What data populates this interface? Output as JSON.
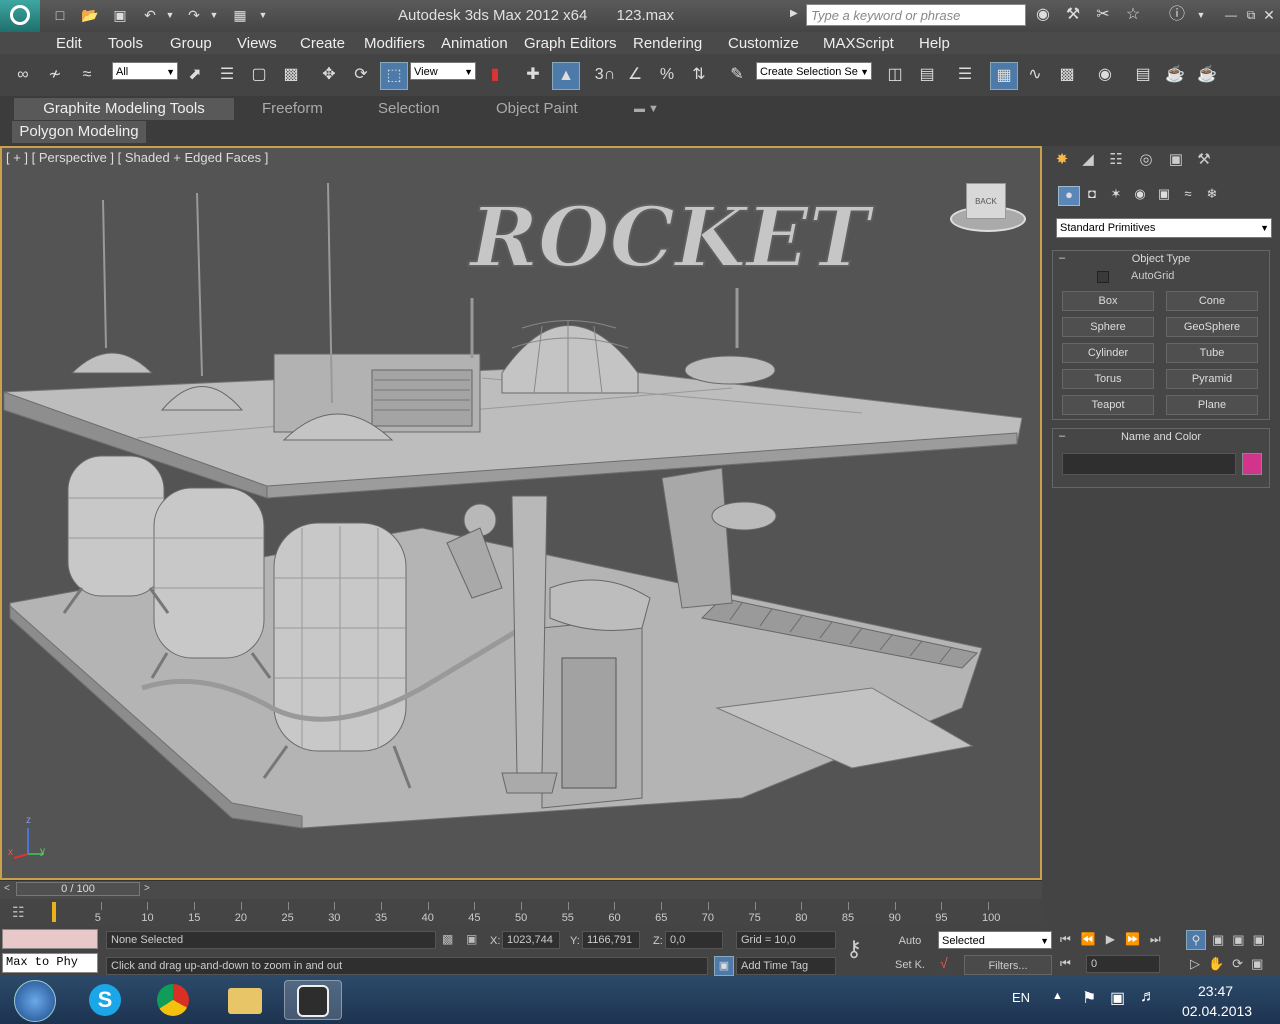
{
  "title_bar": {
    "app_title": "Autodesk 3ds Max  2012 x64",
    "file_name": "123.max",
    "search_placeholder": "Type a keyword or phrase"
  },
  "menu": [
    "Edit",
    "Tools",
    "Group",
    "Views",
    "Create",
    "Modifiers",
    "Animation",
    "Graph Editors",
    "Rendering",
    "Customize",
    "MAXScript",
    "Help"
  ],
  "toolbar": {
    "selection_filter": "All",
    "reference_coord": "View",
    "snap_angle_label": "3",
    "named_selection_placeholder": "Create Selection Se"
  },
  "ribbon": {
    "tabs": [
      "Graphite Modeling Tools",
      "Freeform",
      "Selection",
      "Object Paint"
    ],
    "active_panel": "Polygon Modeling"
  },
  "viewport": {
    "label": "[ + ] [ Perspective ] [ Shaded + Edged Faces ]",
    "sign_text": "ROCKET",
    "viewcube_label": "BACK",
    "axis_labels": {
      "x": "x",
      "y": "y",
      "z": "z"
    }
  },
  "command_panel": {
    "category": "Standard Primitives",
    "object_type_title": "Object Type",
    "autogrid_label": "AutoGrid",
    "autogrid_checked": false,
    "primitives": [
      "Box",
      "Cone",
      "Sphere",
      "GeoSphere",
      "Cylinder",
      "Tube",
      "Torus",
      "Pyramid",
      "Teapot",
      "Plane"
    ],
    "name_color_title": "Name and Color",
    "object_name": "",
    "object_color": "#d1348a"
  },
  "timeline": {
    "frame_display": "0 / 100",
    "ticks": [
      "5",
      "10",
      "15",
      "20",
      "25",
      "30",
      "35",
      "40",
      "45",
      "50",
      "55",
      "60",
      "65",
      "70",
      "75",
      "80",
      "85",
      "90",
      "95",
      "100"
    ]
  },
  "status": {
    "script_listener": "Max to Phy",
    "selection_status": "None Selected",
    "prompt": "Click and drag up-and-down to zoom in and out",
    "x_label": "X:",
    "x_value": "1023,744",
    "y_label": "Y:",
    "y_value": "1166,791",
    "z_label": "Z:",
    "z_value": "0,0",
    "grid": "Grid = 10,0",
    "add_time_tag": "Add Time Tag",
    "auto_key": "Auto",
    "set_key": "Set K.",
    "key_filter": "Selected",
    "filters": "Filters...",
    "current_frame": "0"
  },
  "taskbar": {
    "language": "EN",
    "time": "23:47",
    "date": "02.04.2013"
  },
  "colors": {
    "viewport_border": "#c8a14a",
    "object_color": "#d1348a",
    "accent": "#3fa7a2"
  }
}
